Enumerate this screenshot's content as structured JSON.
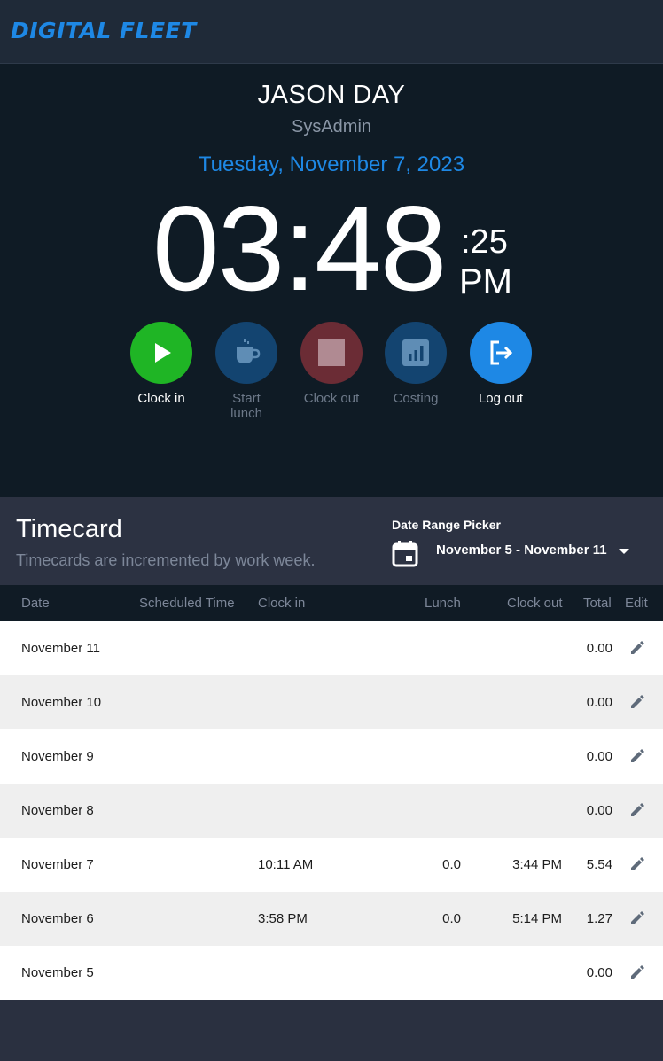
{
  "brand": {
    "logo_text": "DIGITAL FLEET",
    "accent": "#1e88e5"
  },
  "user": {
    "name": "JASON DAY",
    "role": "SysAdmin"
  },
  "clock": {
    "date": "Tuesday, November 7, 2023",
    "time": "03:48",
    "seconds": ":25",
    "ampm": "PM"
  },
  "actions": [
    {
      "label": "Clock in",
      "icon": "play-icon",
      "color": "#1fb525",
      "enabled": true
    },
    {
      "label": "Start lunch",
      "label_line1": "Start",
      "label_line2": "lunch",
      "icon": "coffee-cup-icon",
      "color": "#134470",
      "enabled": false
    },
    {
      "label": "Clock out",
      "icon": "stop-icon",
      "color": "#6b2c35",
      "enabled": false
    },
    {
      "label": "Costing",
      "icon": "bar-chart-icon",
      "color": "#134470",
      "enabled": false
    },
    {
      "label": "Log out",
      "icon": "logout-icon",
      "color": "#1e88e5",
      "enabled": true
    }
  ],
  "timecard": {
    "title": "Timecard",
    "subtitle": "Timecards are incremented by work week.",
    "date_range_label": "Date Range Picker",
    "date_range_value": "November 5 - November 11"
  },
  "table": {
    "headers": {
      "date": "Date",
      "scheduled": "Scheduled Time",
      "clock_in": "Clock in",
      "lunch": "Lunch",
      "clock_out": "Clock out",
      "total": "Total",
      "edit": "Edit"
    },
    "rows": [
      {
        "date": "November 11",
        "clock_in": "",
        "lunch": "",
        "clock_out": "",
        "total": "0.00"
      },
      {
        "date": "November 10",
        "clock_in": "",
        "lunch": "",
        "clock_out": "",
        "total": "0.00"
      },
      {
        "date": "November 9",
        "clock_in": "",
        "lunch": "",
        "clock_out": "",
        "total": "0.00"
      },
      {
        "date": "November 8",
        "clock_in": "",
        "lunch": "",
        "clock_out": "",
        "total": "0.00"
      },
      {
        "date": "November 7",
        "clock_in": "10:11 AM",
        "lunch": "0.0",
        "clock_out": "3:44 PM",
        "total": "5.54"
      },
      {
        "date": "November 6",
        "clock_in": "3:58 PM",
        "lunch": "0.0",
        "clock_out": "5:14 PM",
        "total": "1.27"
      },
      {
        "date": "November 5",
        "clock_in": "",
        "lunch": "",
        "clock_out": "",
        "total": "0.00"
      }
    ]
  }
}
